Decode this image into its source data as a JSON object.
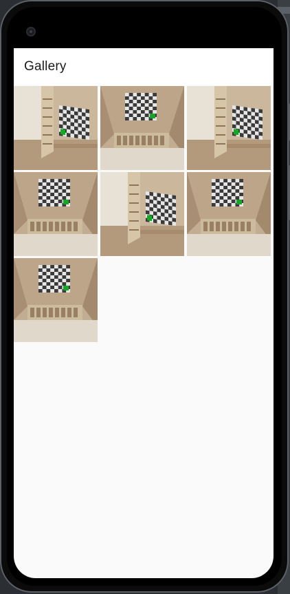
{
  "app": {
    "title": "Gallery"
  },
  "images": [
    {
      "name": "photo-1",
      "view": "wall"
    },
    {
      "name": "photo-2",
      "view": "ceiling"
    },
    {
      "name": "photo-3",
      "view": "wall"
    },
    {
      "name": "photo-4",
      "view": "ceiling"
    },
    {
      "name": "photo-5",
      "view": "wall"
    },
    {
      "name": "photo-6",
      "view": "ceiling"
    },
    {
      "name": "photo-7",
      "view": "ceiling"
    }
  ],
  "colors": {
    "screen_bg": "#fafafa",
    "appbar_bg": "#ffffff",
    "checker_dark": "#3a3a3a",
    "checker_light": "#e6e6e6",
    "marker_green": "#19a529"
  }
}
